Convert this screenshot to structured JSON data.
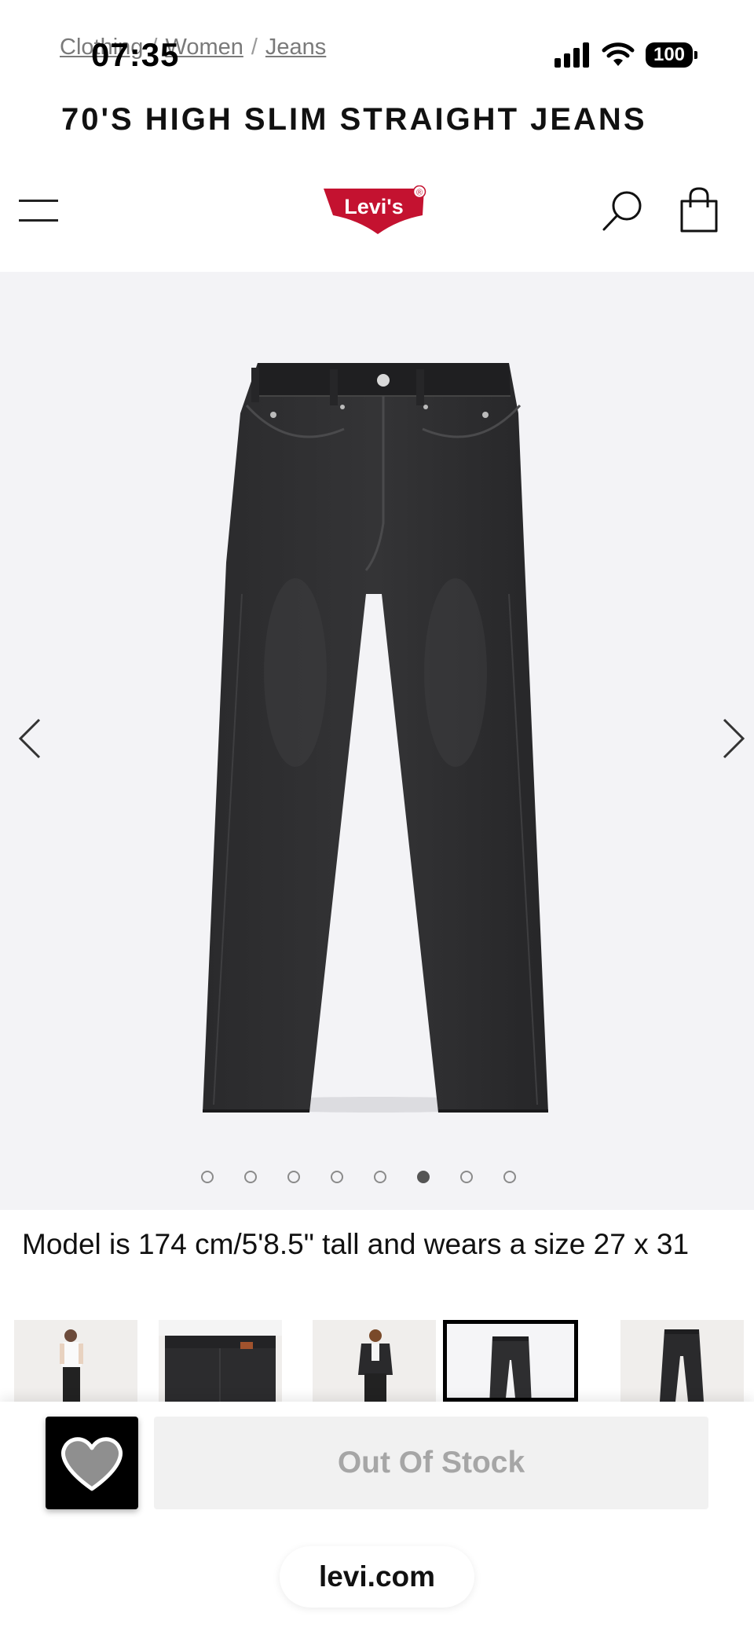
{
  "status_bar": {
    "time": "07:35",
    "battery": "100"
  },
  "breadcrumb": {
    "items": [
      "Clothing",
      "Women",
      "Jeans"
    ],
    "separator": "/"
  },
  "product": {
    "title": "70'S HIGH SLIM STRAIGHT JEANS",
    "model_info": "Model is 174 cm/5'8.5\" tall and wears a size 27 x 31"
  },
  "header": {
    "logo_text": "Levi's",
    "logo_mark": "®",
    "brand_color": "#c41230"
  },
  "icons": {
    "menu": "hamburger-menu-icon",
    "search": "search-icon",
    "bag": "shopping-bag-icon",
    "prev": "chevron-left-icon",
    "next": "chevron-right-icon",
    "wishlist": "heart-icon",
    "signal": "signal-icon",
    "wifi": "wifi-icon"
  },
  "gallery": {
    "total_images": 8,
    "active_index": 5
  },
  "thumbnails": {
    "items": [
      {
        "kind": "model-front"
      },
      {
        "kind": "model-back"
      },
      {
        "kind": "model-jacket"
      },
      {
        "kind": "product-front",
        "selected": true
      },
      {
        "kind": "product-back"
      }
    ]
  },
  "actions": {
    "out_of_stock_label": "Out Of Stock"
  },
  "browser": {
    "url": "levi.com"
  }
}
